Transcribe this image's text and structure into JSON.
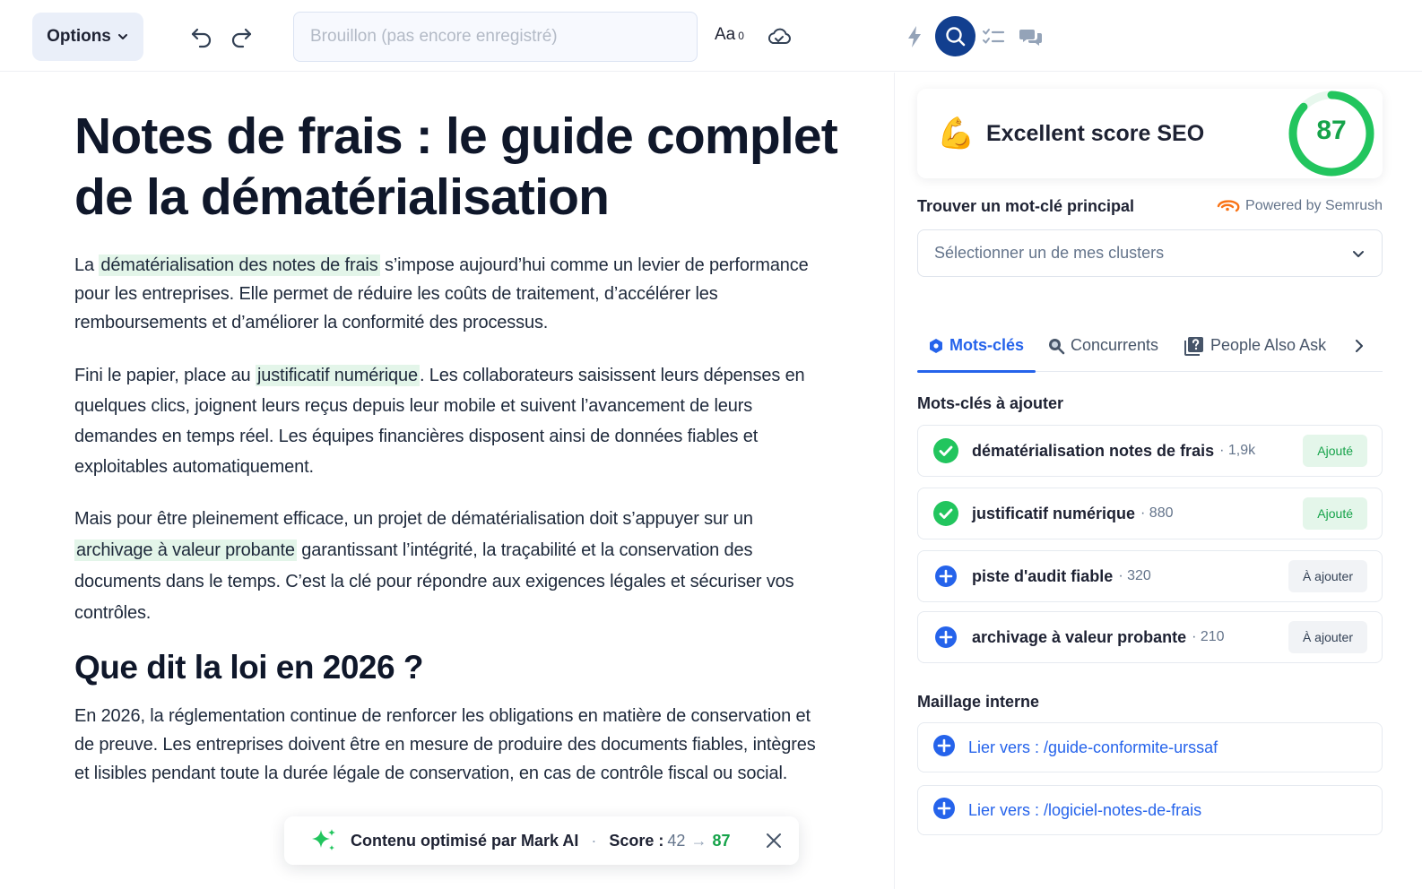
{
  "toolbar": {
    "options_label": "Options",
    "title_placeholder": "Brouillon (pas encore enregistré)",
    "font_label": "Aa",
    "font_count": "0"
  },
  "document": {
    "title": "Notes de frais : le guide complet de la dématérialisation",
    "p1": {
      "before": "La ",
      "highlight": "dématérialisation des notes de frais",
      "after": " s’impose aujourd’hui comme un levier de performance pour les entreprises. Elle permet de réduire les coûts de traitement, d’accélérer les remboursements et d’améliorer la conformité des processus."
    },
    "p2": {
      "before": "Fini le papier, place au ",
      "highlight": "justificatif numérique",
      "after": ".  Les collaborateurs saisissent leurs dépenses en quelques clics, joignent leurs reçus depuis leur mobile et suivent l’avancement de leurs demandes en temps réel. Les équipes financières disposent ainsi de données fiables et exploitables automatiquement."
    },
    "p3": {
      "before": "Mais pour être pleinement efficace, un projet de dématérialisation doit s’appuyer sur un ",
      "highlight": "archivage à valeur probante",
      "after": " garantissant l’intégrité, la traçabilité et la conservation des documents dans le temps. C’est la clé pour répondre aux exigences légales et sécuriser vos contrôles."
    },
    "h2": "Que dit la loi en 2026 ?",
    "p4": "En 2026, la réglementation continue de renforcer les obligations en matière de conservation et de preuve. Les entreprises doivent être en mesure de produire des documents fiables, intègres et lisibles pendant toute la durée légale de conservation, en cas de contrôle fiscal ou social."
  },
  "toast": {
    "label": "Contenu optimisé par Mark AI",
    "separator": "·",
    "score_label": "Score :",
    "score_from": "42",
    "arrow": "→",
    "score_to": "87"
  },
  "seo": {
    "emoji": "💪",
    "score_label": "Excellent score SEO",
    "score": "87",
    "score_fraction": 0.87,
    "score_color": "#22c55e",
    "main_keyword_title": "Trouver un mot-clé principal",
    "powered_by": "Powered by Semrush",
    "cluster_placeholder": "Sélectionner un de mes clusters"
  },
  "tabs": [
    {
      "label": "Mots-clés",
      "icon": "hexagon-icon",
      "active": true
    },
    {
      "label": "Concurrents",
      "icon": "magnifier-icon",
      "active": false
    },
    {
      "label": "People Also Ask",
      "icon": "question-box-icon",
      "active": false
    }
  ],
  "keywords": {
    "section_title": "Mots-clés à ajouter",
    "items": [
      {
        "text": "dématérialisation notes de frais",
        "volume": "· 1,9k",
        "status": "added",
        "button": "Ajouté"
      },
      {
        "text": "justificatif numérique",
        "volume": "· 880",
        "status": "added",
        "button": "Ajouté"
      },
      {
        "text": "piste d'audit fiable",
        "volume": "· 320",
        "status": "todo",
        "button": "À ajouter"
      },
      {
        "text": "archivage à valeur probante",
        "volume": "· 210",
        "status": "todo",
        "button": "À ajouter"
      }
    ]
  },
  "internal_links": {
    "section_title": "Maillage interne",
    "items": [
      {
        "text": "Lier vers : /guide-conformite-urssaf"
      },
      {
        "text": "Lier vers : /logiciel-notes-de-frais"
      }
    ]
  },
  "colors": {
    "accent": "#2563eb",
    "success": "#16a34a",
    "highlight": "#e3f5e9",
    "search_toggle": "#123f8f"
  }
}
